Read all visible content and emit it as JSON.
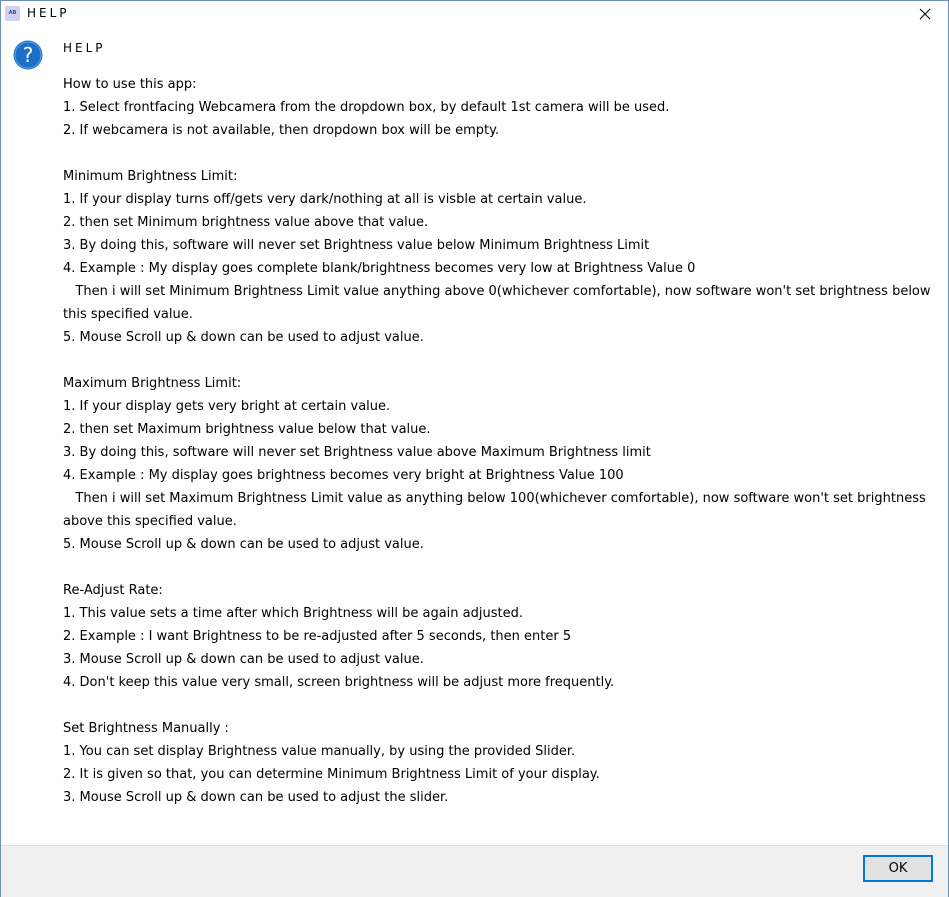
{
  "window": {
    "title": "HELP",
    "app_icon_text": "AB"
  },
  "content": {
    "header": "HELP",
    "lines": [
      "How to use this app:",
      "1. Select frontfacing Webcamera from the dropdown box, by default 1st camera will be used.",
      "2. If webcamera is not available, then dropdown box will be empty.",
      "",
      "Minimum Brightness Limit:",
      "1. If your display turns off/gets very dark/nothing at all is visble at certain value.",
      "2. then set Minimum brightness value above that value.",
      "3. By doing this, software will never set Brightness value below Minimum Brightness Limit",
      "4. Example : My display goes complete blank/brightness becomes very low at Brightness Value 0",
      "   Then i will set Minimum Brightness Limit value anything above 0(whichever comfortable), now software won't set brightness below this specified value.",
      "5. Mouse Scroll up & down can be used to adjust value.",
      "",
      "Maximum Brightness Limit:",
      "1. If your display gets very bright at certain value.",
      "2. then set Maximum brightness value below that value.",
      "3. By doing this, software will never set Brightness value above Maximum Brightness limit",
      "4. Example : My display goes brightness becomes very bright at Brightness Value 100",
      "   Then i will set Maximum Brightness Limit value as anything below 100(whichever comfortable), now software won't set brightness above this specified value.",
      "5. Mouse Scroll up & down can be used to adjust value.",
      "",
      "Re-Adjust Rate:",
      "1. This value sets a time after which Brightness will be again adjusted.",
      "2. Example : I want Brightness to be re-adjusted after 5 seconds, then enter 5",
      "3. Mouse Scroll up & down can be used to adjust value.",
      "4. Don't keep this value very small, screen brightness will be adjust more frequently.",
      "",
      "Set Brightness Manually :",
      "1. You can set display Brightness value manually, by using the provided Slider.",
      "2. It is given so that, you can determine Minimum Brightness Limit of your display.",
      "3. Mouse Scroll up & down can be used to adjust the slider."
    ]
  },
  "footer": {
    "ok_label": "OK"
  },
  "icons": {
    "help": "question-mark-circle",
    "close": "close-x",
    "app": "app-logo"
  },
  "colors": {
    "help_icon_fill": "#1e6fc8",
    "ok_border": "#0078d7",
    "footer_bg": "#f0f0f0"
  }
}
